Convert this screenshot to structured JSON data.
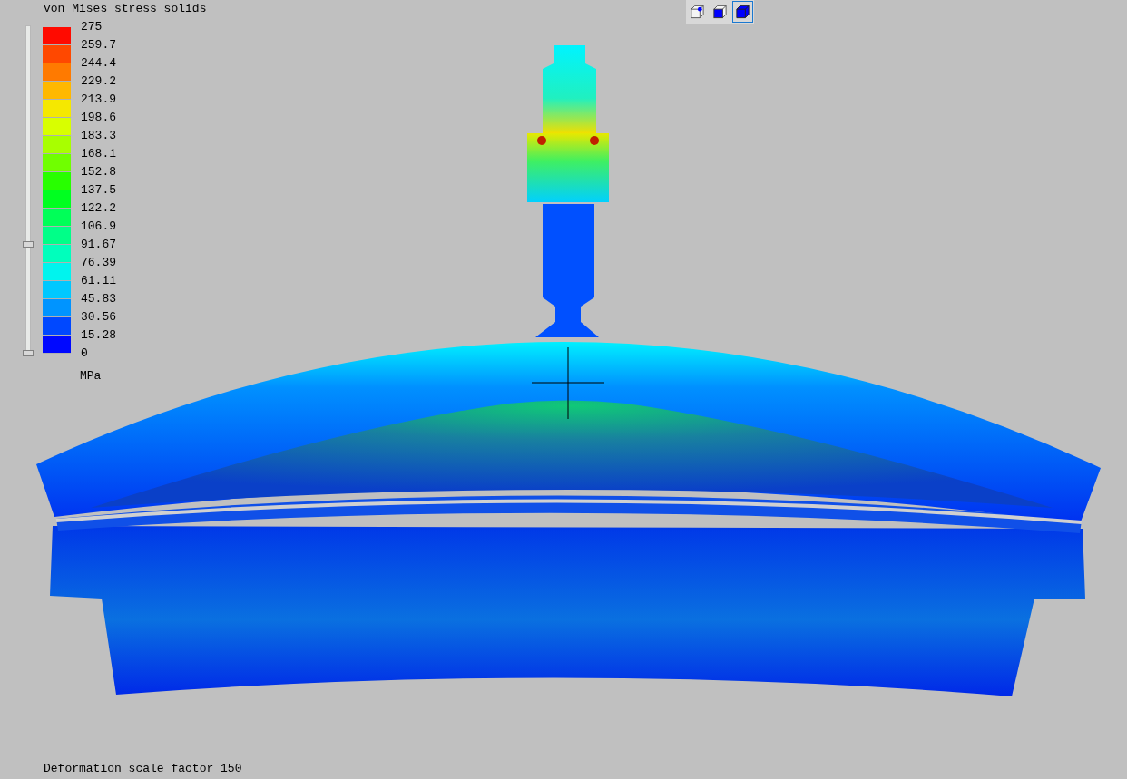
{
  "legend": {
    "title": "von Mises stress solids",
    "labels": [
      "275",
      "259.7",
      "244.4",
      "229.2",
      "213.9",
      "198.6",
      "183.3",
      "168.1",
      "152.8",
      "137.5",
      "122.2",
      "106.9",
      "91.67",
      "76.39",
      "61.11",
      "45.83",
      "30.56",
      "15.28",
      "0"
    ],
    "bands": [
      {
        "color": "#ff0a00"
      },
      {
        "color": "#ff4800"
      },
      {
        "color": "#ff7a00"
      },
      {
        "color": "#ffb800"
      },
      {
        "color": "#f5e800"
      },
      {
        "color": "#d8ff00"
      },
      {
        "color": "#a8ff00"
      },
      {
        "color": "#70ff00"
      },
      {
        "color": "#28ff00"
      },
      {
        "color": "#00ff20"
      },
      {
        "color": "#00ff58"
      },
      {
        "color": "#00ff88"
      },
      {
        "color": "#00ffbc"
      },
      {
        "color": "#00f4ee"
      },
      {
        "color": "#00c8ff"
      },
      {
        "color": "#0094ff"
      },
      {
        "color": "#0048ff"
      },
      {
        "color": "#0008ff"
      }
    ],
    "unit": "MPa",
    "slider": {
      "upper": {
        "level": 0.333
      },
      "lower": {
        "level": 0
      }
    }
  },
  "view_buttons": [
    {
      "kind": "wireframe",
      "selected": false
    },
    {
      "kind": "front-face",
      "selected": false
    },
    {
      "kind": "solid",
      "selected": true
    }
  ],
  "status": "Deformation scale factor 150"
}
